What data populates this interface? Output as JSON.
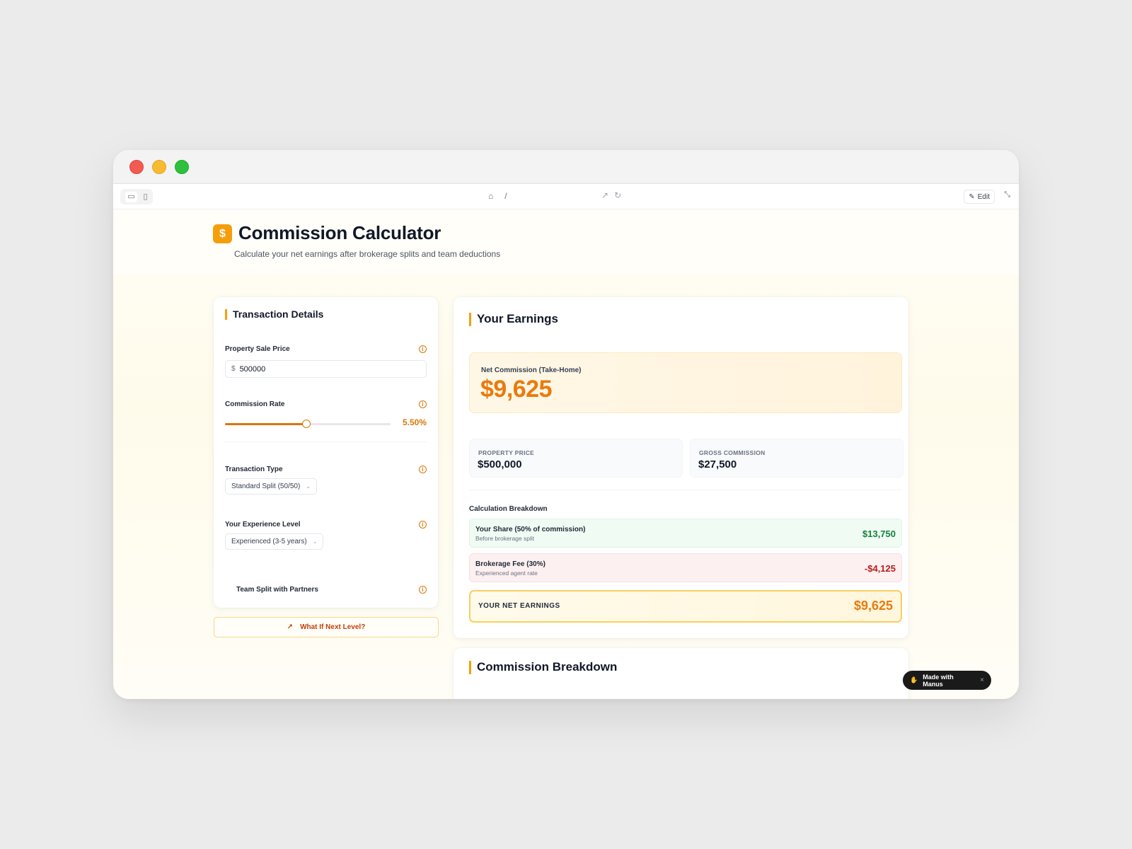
{
  "toolbar": {
    "address": "/",
    "edit_label": "Edit"
  },
  "header": {
    "logo_symbol": "$",
    "title": "Commission Calculator",
    "subtitle": "Calculate your net earnings after brokerage splits and team deductions"
  },
  "transaction": {
    "title": "Transaction Details",
    "sale_price_label": "Property Sale Price",
    "currency_symbol": "$",
    "sale_price_value": "500000",
    "commission_rate_label": "Commission Rate",
    "commission_rate_value": "5.50%",
    "commission_rate_fraction": 0.49,
    "transaction_type_label": "Transaction Type",
    "transaction_type_value": "Standard Split (50/50)",
    "experience_label": "Your Experience Level",
    "experience_value": "Experienced (3-5 years)",
    "team_split_label": "Team Split with Partners",
    "what_if_label": "What If Next Level?"
  },
  "earnings": {
    "title": "Your Earnings",
    "net_label": "Net Commission (Take-Home)",
    "net_value": "$9,625",
    "property_price_label": "PROPERTY PRICE",
    "property_price_value": "$500,000",
    "gross_label": "GROSS COMMISSION",
    "gross_value": "$27,500",
    "breakdown_title": "Calculation Breakdown",
    "share_label": "Your Share (50% of commission)",
    "share_sub": "Before brokerage split",
    "share_value": "$13,750",
    "fee_label": "Brokerage Fee (30%)",
    "fee_sub": "Experienced agent rate",
    "fee_value": "-$4,125",
    "total_label": "YOUR NET EARNINGS",
    "total_value": "$9,625"
  },
  "commission_breakdown": {
    "title": "Commission Breakdown"
  },
  "badge": {
    "label": "Made with Manus",
    "close": "×"
  },
  "colors": {
    "accent": "#f59e0b",
    "accent_text": "#ea7a0c",
    "positive": "#15803d",
    "negative": "#b91c1c"
  }
}
